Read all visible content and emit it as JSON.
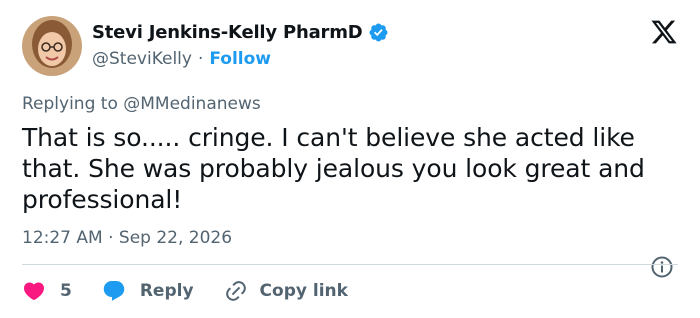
{
  "author": {
    "display_name": "Stevi Jenkins-Kelly PharmD",
    "handle": "@SteviKelly",
    "follow_label": "Follow",
    "separator": "·"
  },
  "tweet": {
    "replying_prefix": "Replying to",
    "replying_to": "@MMedinanews",
    "text": "That is so..... cringe. I can't believe she acted like that. She was probably jealous you look great and professional!",
    "timestamp": "12:27 AM · Sep 22, 2026"
  },
  "actions": {
    "like_count": "5",
    "reply_label": "Reply",
    "copy_label": "Copy link"
  },
  "colors": {
    "accent": "#1d9bf0",
    "like": "#f91880",
    "secondary_text": "#536471",
    "primary_text": "#0f1419"
  },
  "icons": {
    "verified": "verified-badge-icon",
    "brand": "x-logo-icon",
    "info": "info-icon",
    "like": "heart-icon",
    "reply": "speech-bubble-icon",
    "copy": "link-icon"
  }
}
